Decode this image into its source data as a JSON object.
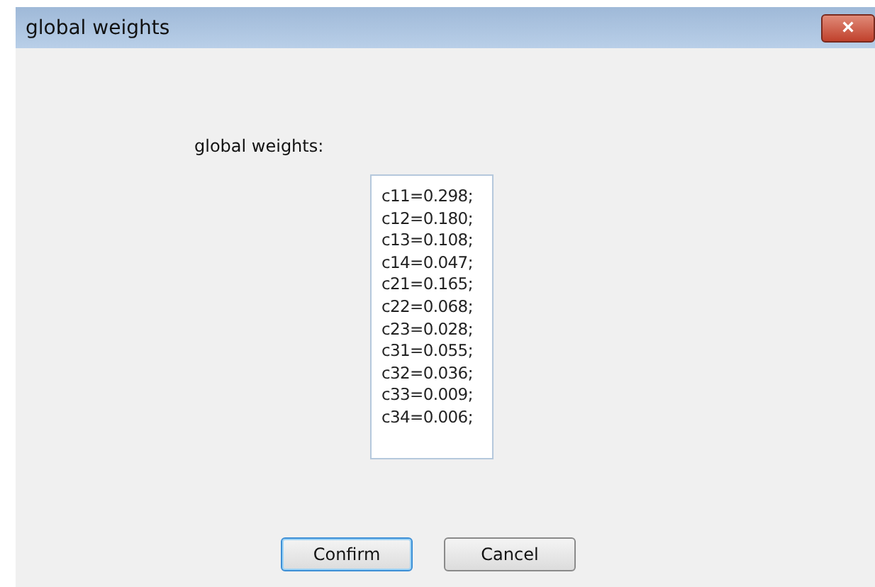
{
  "window": {
    "title": "global weights",
    "close": "×"
  },
  "label": "global weights:",
  "weights": [
    "c11=0.298;",
    "c12=0.180;",
    "c13=0.108;",
    "c14=0.047;",
    "c21=0.165;",
    "c22=0.068;",
    "c23=0.028;",
    "c31=0.055;",
    "c32=0.036;",
    "c33=0.009;",
    "c34=0.006;"
  ],
  "buttons": [
    {
      "label": "Confirm",
      "default": true
    },
    {
      "label": "Cancel",
      "default": false
    }
  ]
}
